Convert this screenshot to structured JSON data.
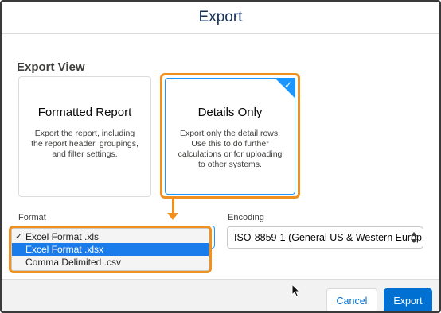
{
  "modal": {
    "title": "Export"
  },
  "export_view": {
    "label": "Export View",
    "cards": [
      {
        "title": "Formatted Report",
        "description": "Export the report, including the report header, groupings, and filter settings.",
        "selected": false
      },
      {
        "title": "Details Only",
        "description": "Export only the detail rows. Use this to do further calculations or for uploading to other systems.",
        "selected": true
      }
    ]
  },
  "format": {
    "label": "Format",
    "options": [
      "Excel Format .xls",
      "Excel Format .xlsx",
      "Comma Delimited .csv"
    ],
    "checked_option": "Excel Format .xls",
    "highlighted_option": "Excel Format .xlsx",
    "check_glyph": "✓"
  },
  "encoding": {
    "label": "Encoding",
    "value": "ISO-8859-1 (General US & Western Europ"
  },
  "footer": {
    "cancel_label": "Cancel",
    "export_label": "Export"
  },
  "icons": {
    "selected_check": "check-icon",
    "cursor": "mouse-pointer-icon",
    "select_arrows": "up-down-arrows-icon"
  },
  "colors": {
    "accent": "#0070d2",
    "annotation": "#f0901e",
    "selection": "#1b96ff"
  }
}
